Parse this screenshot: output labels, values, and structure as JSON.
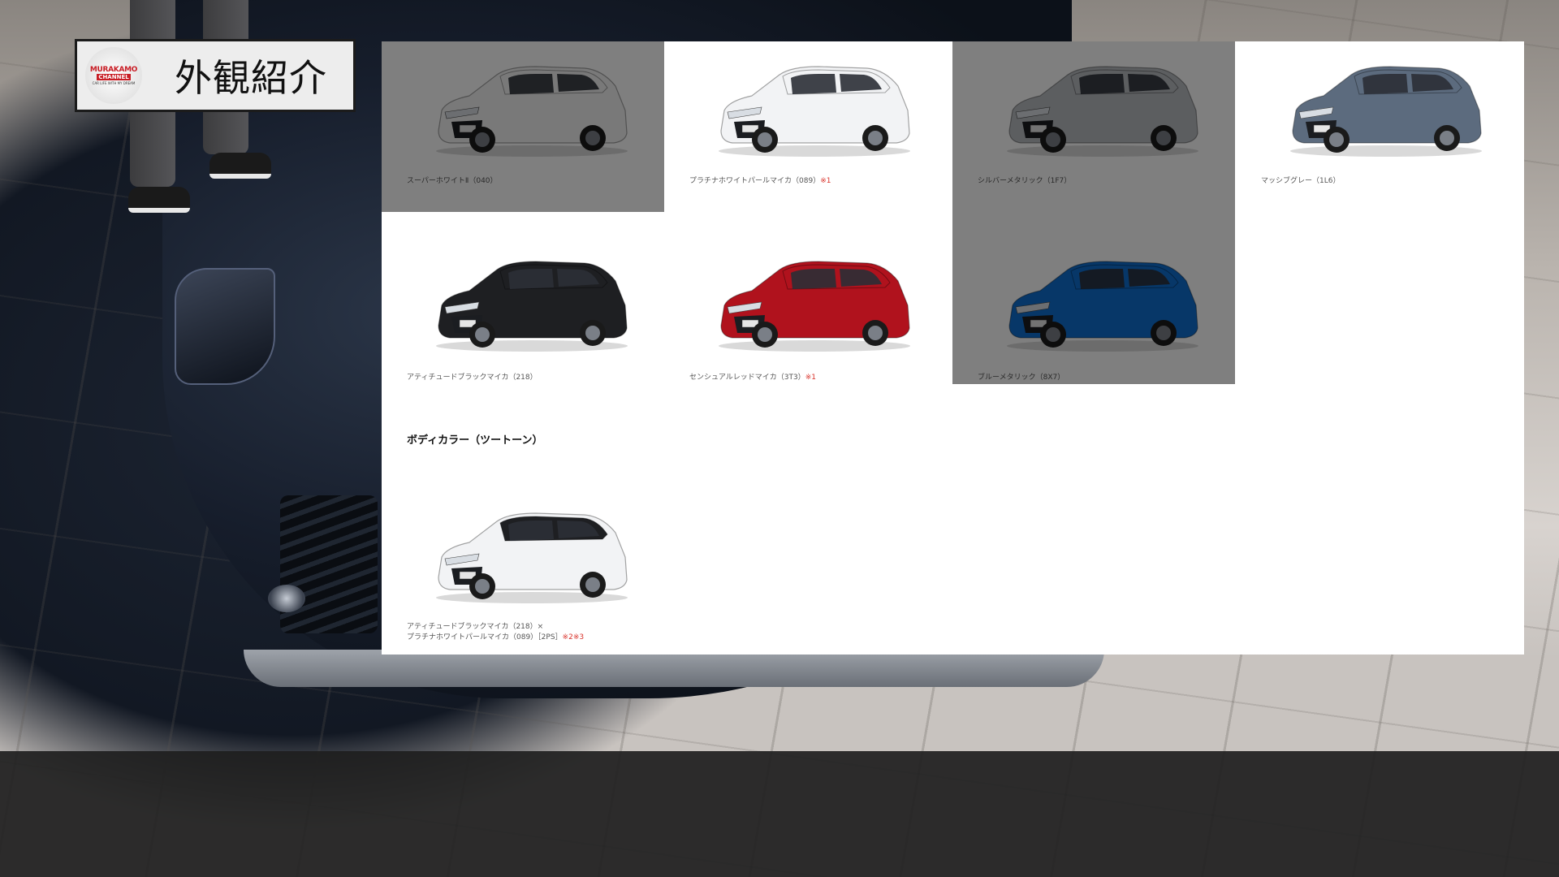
{
  "header": {
    "title": "外観紹介",
    "logo": {
      "name": "MURAKAMO",
      "sub": "CHANNEL",
      "tagline": "CAR LIFE WITH MY DREAM"
    }
  },
  "panel": {
    "section_twotone_heading": "ボディカラー（ツートーン）",
    "colors": [
      {
        "label": "スーパーホワイトⅡ（040）",
        "note": "",
        "body": "#f3f3f3",
        "roof": "#f3f3f3",
        "dimmed": true
      },
      {
        "label": "プラチナホワイトパールマイカ（089）",
        "note": "※1",
        "body": "#f2f3f5",
        "roof": "#f2f3f5",
        "dimmed": false
      },
      {
        "label": "シルバーメタリック（1F7）",
        "note": "",
        "body": "#b9bcc1",
        "roof": "#b9bcc1",
        "dimmed": true
      },
      {
        "label": "マッシブグレー（1L6）",
        "note": "",
        "body": "#5c6b7e",
        "roof": "#5c6b7e",
        "dimmed": false
      },
      {
        "label": "アティチュードブラックマイカ（218）",
        "note": "",
        "body": "#1e1f22",
        "roof": "#1e1f22",
        "dimmed": false
      },
      {
        "label": "センシュアルレッドマイカ（3T3）",
        "note": "※1",
        "body": "#b0121d",
        "roof": "#b0121d",
        "dimmed": false
      },
      {
        "label": "ブルーメタリック（8X7）",
        "note": "",
        "body": "#0e6fd1",
        "roof": "#0e6fd1",
        "dimmed": true
      }
    ],
    "twotone": {
      "label_line1": "アティチュードブラックマイカ（218）×",
      "label_line2": "プラチナホワイトパールマイカ（089）［2PS］",
      "note": "※2※3",
      "body": "#f2f3f5",
      "roof": "#1e1f22"
    }
  }
}
